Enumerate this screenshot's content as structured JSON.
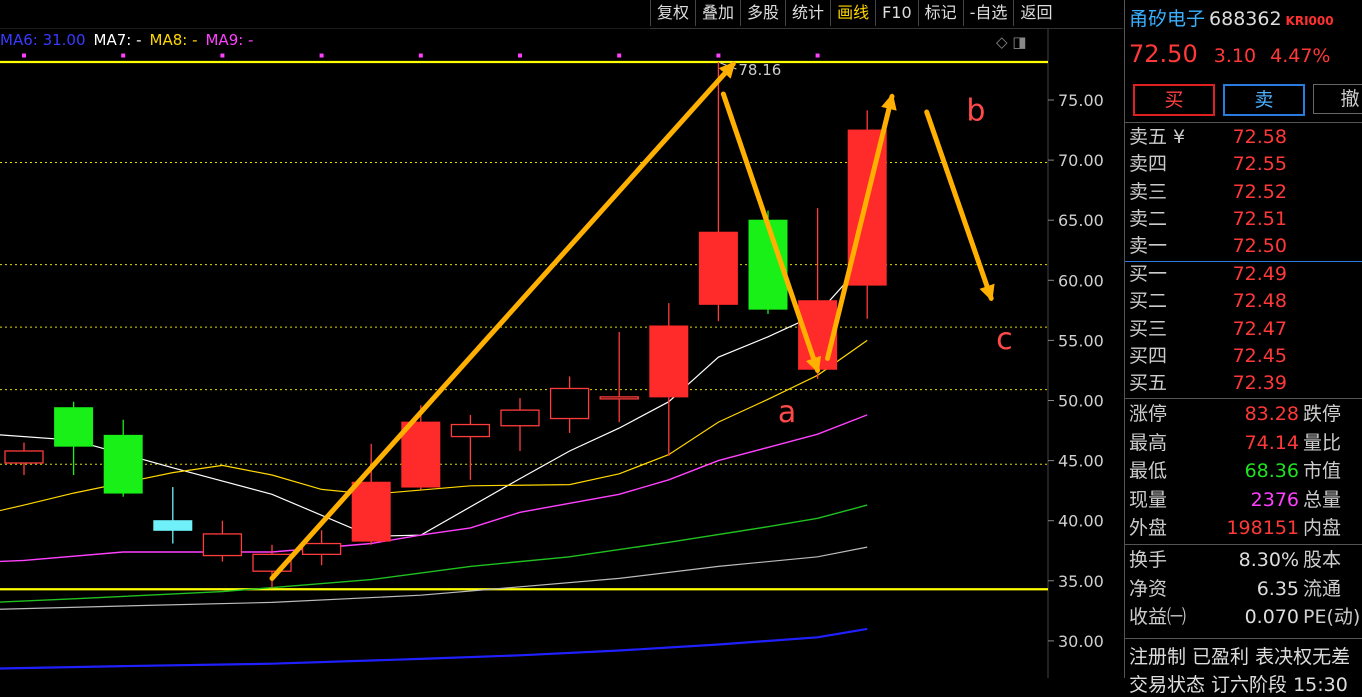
{
  "toolbar": {
    "buttons": [
      "复权",
      "叠加",
      "多股",
      "统计",
      "画线",
      "F10",
      "标记",
      "-自选",
      "返回"
    ],
    "active": "画线"
  },
  "ma_legend": [
    {
      "label": "MA6: 31.00",
      "color": "#3a3aff"
    },
    {
      "label": "MA7: -",
      "color": "#ffffff"
    },
    {
      "label": "MA8: -",
      "color": "#ffd700"
    },
    {
      "label": "MA9: -",
      "color": "#ff40ff"
    }
  ],
  "chart_icons": "◇ ◨",
  "chart_data": {
    "type": "candlestick",
    "y_axis_ticks": [
      "75.00",
      "70.00",
      "65.00",
      "60.00",
      "55.00",
      "50.00",
      "45.00",
      "40.00",
      "35.00",
      "30.00"
    ],
    "ylim": [
      28.5,
      79.5
    ],
    "grid": "dotted-horizontal",
    "candles": [
      {
        "open": 44.8,
        "close": 45.8,
        "high": 46.5,
        "low": 43.8
      },
      {
        "open": 49.4,
        "close": 46.2,
        "high": 49.9,
        "low": 43.8
      },
      {
        "open": 47.1,
        "close": 42.3,
        "high": 48.4,
        "low": 42.0
      },
      {
        "open": 40.0,
        "close": 39.2,
        "high": 42.8,
        "low": 38.1
      },
      {
        "open": 37.1,
        "close": 38.9,
        "high": 40.0,
        "low": 36.6
      },
      {
        "open": 35.8,
        "close": 37.2,
        "high": 38.0,
        "low": 34.4
      },
      {
        "open": 37.2,
        "close": 38.1,
        "high": 39.2,
        "low": 36.3
      },
      {
        "open": 38.3,
        "close": 43.2,
        "high": 46.4,
        "low": 38.0
      },
      {
        "open": 42.8,
        "close": 48.2,
        "high": 49.6,
        "low": 42.6
      },
      {
        "open": 47.0,
        "close": 48.0,
        "high": 48.8,
        "low": 43.4
      },
      {
        "open": 47.9,
        "close": 49.2,
        "high": 50.2,
        "low": 45.8
      },
      {
        "open": 48.5,
        "close": 51.0,
        "high": 52.0,
        "low": 47.3
      },
      {
        "open": 50.2,
        "close": 50.3,
        "high": 55.7,
        "low": 48.2
      },
      {
        "open": 50.3,
        "close": 56.2,
        "high": 58.1,
        "low": 45.4
      },
      {
        "open": 58.0,
        "close": 64.0,
        "high": 78.16,
        "low": 56.6
      },
      {
        "open": 65.0,
        "close": 57.6,
        "high": 65.8,
        "low": 57.2
      },
      {
        "open": 52.6,
        "close": 58.3,
        "high": 66.0,
        "low": 51.8
      },
      {
        "open": 59.6,
        "close": 72.5,
        "high": 74.14,
        "low": 56.8
      }
    ],
    "ma_lines": [
      {
        "color": "#ffffff",
        "width": 1.2,
        "points": [
          [
            -1.7,
            47.0
          ],
          [
            -1.0,
            47.3
          ],
          [
            1.0,
            46.7
          ],
          [
            3.0,
            44.4
          ],
          [
            5.0,
            42.2
          ],
          [
            7.0,
            38.7
          ],
          [
            8.0,
            38.8
          ],
          [
            10.0,
            43.5
          ],
          [
            11.0,
            45.8
          ],
          [
            12.0,
            47.7
          ],
          [
            13.0,
            49.9
          ],
          [
            14.0,
            53.6
          ],
          [
            15.0,
            55.3
          ],
          [
            16.0,
            57.2
          ],
          [
            17.0,
            61.8
          ]
        ]
      },
      {
        "color": "#ffd700",
        "width": 1.2,
        "points": [
          [
            -1.7,
            39.7
          ],
          [
            0.0,
            41.3
          ],
          [
            1.0,
            42.3
          ],
          [
            3.0,
            44.0
          ],
          [
            4.0,
            44.6
          ],
          [
            5.0,
            43.8
          ],
          [
            6.0,
            42.6
          ],
          [
            7.0,
            42.2
          ],
          [
            9.0,
            42.9
          ],
          [
            11.0,
            43.0
          ],
          [
            12.0,
            43.9
          ],
          [
            13.0,
            45.5
          ],
          [
            14.0,
            48.2
          ],
          [
            15.0,
            50.1
          ],
          [
            16.0,
            52.1
          ],
          [
            17.0,
            55.0
          ]
        ]
      },
      {
        "color": "#ff40ff",
        "width": 1.4,
        "points": [
          [
            -1.7,
            36.4
          ],
          [
            0.0,
            36.7
          ],
          [
            2.0,
            37.4
          ],
          [
            5.0,
            37.4
          ],
          [
            7.0,
            38.1
          ],
          [
            8.0,
            38.8
          ],
          [
            9.0,
            39.4
          ],
          [
            10.0,
            40.7
          ],
          [
            12.0,
            42.2
          ],
          [
            13.0,
            43.4
          ],
          [
            14.0,
            45.0
          ],
          [
            15.0,
            46.1
          ],
          [
            16.0,
            47.2
          ],
          [
            17.0,
            48.8
          ]
        ]
      },
      {
        "color": "#20c020",
        "width": 1.4,
        "points": [
          [
            -1.7,
            33.0
          ],
          [
            1.0,
            33.5
          ],
          [
            4.0,
            34.1
          ],
          [
            7.0,
            35.1
          ],
          [
            9.0,
            36.2
          ],
          [
            11.0,
            37.0
          ],
          [
            13.0,
            38.2
          ],
          [
            15.0,
            39.5
          ],
          [
            16.0,
            40.2
          ],
          [
            17.0,
            41.3
          ]
        ]
      },
      {
        "color": "#bbbbbb",
        "width": 1.2,
        "points": [
          [
            -1.7,
            32.5
          ],
          [
            2.0,
            32.9
          ],
          [
            5.0,
            33.2
          ],
          [
            8.0,
            33.8
          ],
          [
            10.0,
            34.5
          ],
          [
            12.0,
            35.2
          ],
          [
            14.0,
            36.2
          ],
          [
            16.0,
            37.0
          ],
          [
            17.0,
            37.8
          ]
        ]
      },
      {
        "color": "#2020ff",
        "width": 2.2,
        "points": [
          [
            -1.7,
            27.6
          ],
          [
            2.0,
            27.9
          ],
          [
            5.0,
            28.1
          ],
          [
            8.0,
            28.5
          ],
          [
            10.0,
            28.8
          ],
          [
            12.0,
            29.2
          ],
          [
            14.0,
            29.7
          ],
          [
            16.0,
            30.3
          ],
          [
            17.0,
            31.0
          ]
        ]
      }
    ],
    "horizontal_lines": [
      {
        "y": 78.16,
        "color": "#ffff00",
        "style": "solid"
      },
      {
        "y": 34.3,
        "color": "#ffff00",
        "style": "solid"
      },
      {
        "y": 69.8,
        "color": "#dddd00",
        "style": "dotted"
      },
      {
        "y": 61.3,
        "color": "#dddd00",
        "style": "dotted"
      },
      {
        "y": 56.1,
        "color": "#dddd00",
        "style": "dotted"
      },
      {
        "y": 50.9,
        "color": "#dddd00",
        "style": "dotted"
      },
      {
        "y": 44.7,
        "color": "#dddd00",
        "style": "dotted"
      }
    ],
    "marker_dots_row": {
      "y": 78.7,
      "indices": [
        -1,
        0,
        2,
        4,
        6,
        8,
        10,
        12,
        14,
        16
      ]
    },
    "high_annotation": {
      "text": "78.16",
      "index": 14,
      "value": 78.16
    },
    "arrows": [
      {
        "from": [
          5.0,
          35.2
        ],
        "to": [
          14.3,
          78.0
        ]
      },
      {
        "from": [
          14.1,
          75.5
        ],
        "to": [
          16.0,
          52.5
        ]
      },
      {
        "from": [
          16.2,
          53.5
        ],
        "to": [
          17.5,
          75.3
        ]
      },
      {
        "from": [
          18.2,
          74.0
        ],
        "to": [
          19.5,
          58.5
        ]
      }
    ],
    "wave_labels": [
      {
        "text": "a",
        "index": 15.2,
        "value": 48.2
      },
      {
        "text": "b",
        "index": 19.0,
        "value": 73.3
      },
      {
        "text": "c",
        "index": 19.6,
        "value": 54.3
      }
    ]
  },
  "stock": {
    "name": "甬矽电子",
    "code": "688362",
    "badge": "KRI000",
    "price": "72.50",
    "change": "3.10",
    "change_pct": "4.47%"
  },
  "trade_buttons": {
    "buy": "买",
    "sell": "卖",
    "cancel": "撤"
  },
  "order_book": {
    "asks": [
      {
        "label": "卖五 ¥",
        "price": "72.58"
      },
      {
        "label": "卖四",
        "price": "72.55"
      },
      {
        "label": "卖三",
        "price": "72.52"
      },
      {
        "label": "卖二",
        "price": "72.51"
      },
      {
        "label": "卖一",
        "price": "72.50"
      }
    ],
    "bids": [
      {
        "label": "买一",
        "price": "72.49"
      },
      {
        "label": "买二",
        "price": "72.48"
      },
      {
        "label": "买三",
        "price": "72.47"
      },
      {
        "label": "买四",
        "price": "72.45"
      },
      {
        "label": "买五",
        "price": "72.39"
      }
    ]
  },
  "stats": [
    {
      "label": "涨停",
      "value": "83.28",
      "color": "#ff3838",
      "label2": "跌停"
    },
    {
      "label": "最高",
      "value": "74.14",
      "color": "#ff3838",
      "label2": "量比"
    },
    {
      "label": "最低",
      "value": "68.36",
      "color": "#20e020",
      "label2": "市值"
    },
    {
      "label": "现量",
      "value": "2376",
      "color": "#ff40ff",
      "label2": "总量"
    },
    {
      "label": "外盘",
      "value": "198151",
      "color": "#ff3838",
      "label2": "内盘"
    }
  ],
  "stats2": [
    {
      "label": "换手",
      "value": "8.30%",
      "color": "#dddddd",
      "label2": "股本"
    },
    {
      "label": "净资",
      "value": "6.35",
      "color": "#dddddd",
      "label2": "流通"
    },
    {
      "label": "收益㈠",
      "value": "0.070",
      "color": "#dddddd",
      "label2": "PE(动)"
    }
  ],
  "footer": "注册制 已盈利 表决权无差",
  "footer2": "交易状态 订六阶段 15:30"
}
